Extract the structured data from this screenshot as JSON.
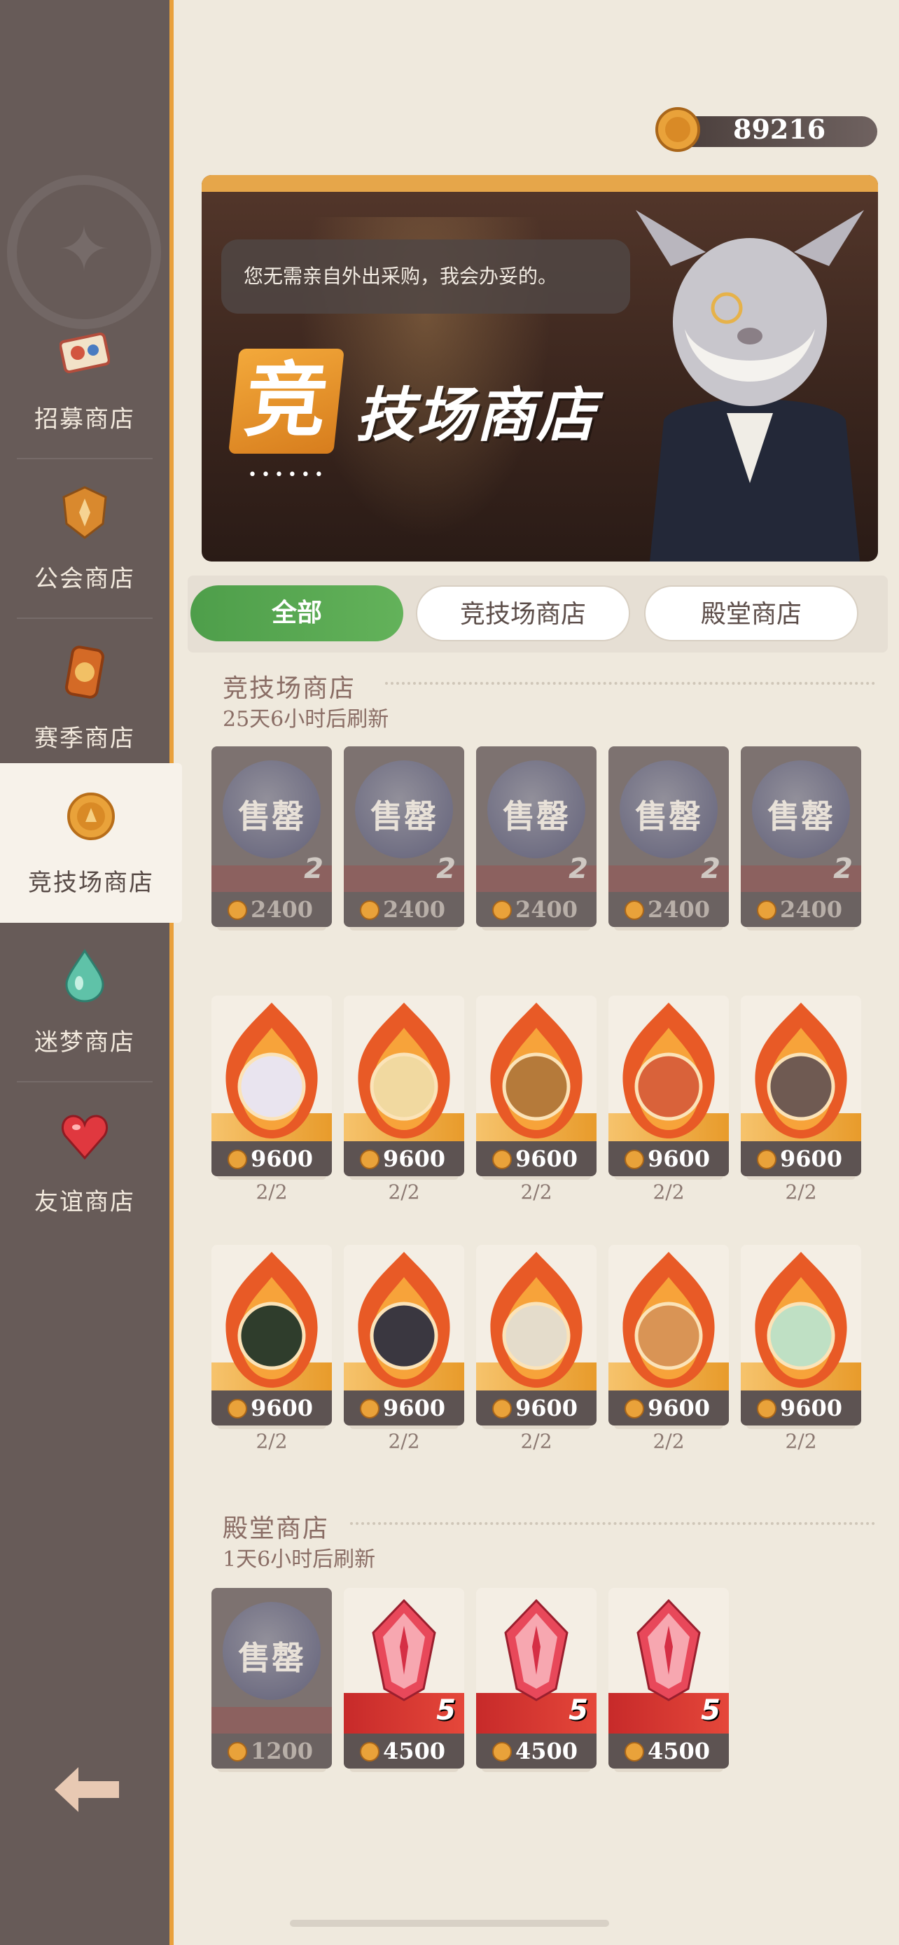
{
  "currency": {
    "amount": "89216"
  },
  "sidebar": {
    "items": [
      {
        "label": "招募商店",
        "icon": "recruit-ticket-icon"
      },
      {
        "label": "公会商店",
        "icon": "guild-emblem-icon"
      },
      {
        "label": "赛季商店",
        "icon": "season-badge-icon"
      },
      {
        "label": "竞技场商店",
        "icon": "arena-coin-icon",
        "active": true
      },
      {
        "label": "迷梦商店",
        "icon": "dream-drop-icon"
      },
      {
        "label": "友谊商店",
        "icon": "heart-icon"
      }
    ],
    "back_icon": "back-arrow-icon"
  },
  "banner": {
    "speech": "您无需亲自外出采购，我会办妥的。",
    "title_first": "竞",
    "title_rest": "技场商店",
    "dots": "••••••"
  },
  "tabs": [
    {
      "label": "全部",
      "active": true
    },
    {
      "label": "竞技场商店",
      "active": false
    },
    {
      "label": "殿堂商店",
      "active": false
    }
  ],
  "arena_section": {
    "title": "竞技场商店",
    "refresh": "25天6小时后刷新",
    "sold_row": [
      {
        "sold_label": "售罄",
        "qty": "2",
        "price": "2400"
      },
      {
        "sold_label": "售罄",
        "qty": "2",
        "price": "2400"
      },
      {
        "sold_label": "售罄",
        "qty": "2",
        "price": "2400"
      },
      {
        "sold_label": "售罄",
        "qty": "2",
        "price": "2400"
      },
      {
        "sold_label": "售罄",
        "qty": "2",
        "price": "2400"
      }
    ],
    "hero_row_1": [
      {
        "price": "9600",
        "limit": "2/2",
        "portrait_color": "#e9e4ef"
      },
      {
        "price": "9600",
        "limit": "2/2",
        "portrait_color": "#f1d9a0"
      },
      {
        "price": "9600",
        "limit": "2/2",
        "portrait_color": "#b57a3a"
      },
      {
        "price": "9600",
        "limit": "2/2",
        "portrait_color": "#d9623a"
      },
      {
        "price": "9600",
        "limit": "2/2",
        "portrait_color": "#6f5a52"
      }
    ],
    "hero_row_2": [
      {
        "price": "9600",
        "limit": "2/2",
        "portrait_color": "#2f3d2c"
      },
      {
        "price": "9600",
        "limit": "2/2",
        "portrait_color": "#3a3740"
      },
      {
        "price": "9600",
        "limit": "2/2",
        "portrait_color": "#e4dccb"
      },
      {
        "price": "9600",
        "limit": "2/2",
        "portrait_color": "#d99455"
      },
      {
        "price": "9600",
        "limit": "2/2",
        "portrait_color": "#bfe0c4"
      }
    ]
  },
  "hall_section": {
    "title": "殿堂商店",
    "refresh": "1天6小时后刷新",
    "items": [
      {
        "sold": true,
        "sold_label": "售罄",
        "price": "1200"
      },
      {
        "sold": false,
        "qty": "5",
        "price": "4500"
      },
      {
        "sold": false,
        "qty": "5",
        "price": "4500"
      },
      {
        "sold": false,
        "qty": "5",
        "price": "4500"
      }
    ]
  }
}
